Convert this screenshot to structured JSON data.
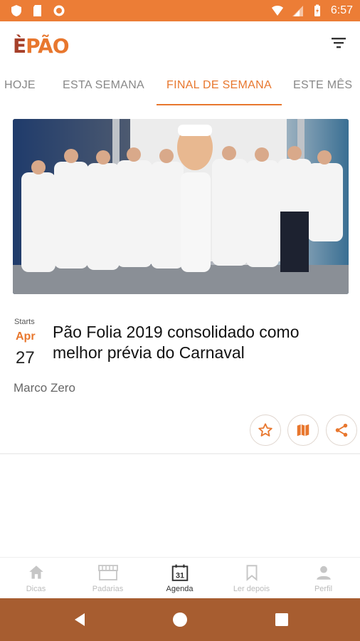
{
  "status_bar": {
    "time": "6:57"
  },
  "app": {
    "logo_prefix": "È",
    "logo_main": "PÃO"
  },
  "tabs": [
    {
      "label": "HOJE"
    },
    {
      "label": "ESTA SEMANA"
    },
    {
      "label": "FINAL DE SEMANA",
      "active": true
    },
    {
      "label": "ESTE MÊS"
    }
  ],
  "event": {
    "starts_label": "Starts",
    "month": "Apr",
    "day": "27",
    "title": "Pão Folia 2019 consolidado como melhor prévia do Carnaval",
    "venue": "Marco Zero"
  },
  "bottom_nav": [
    {
      "label": "Dicas",
      "icon": "home-icon"
    },
    {
      "label": "Padarias",
      "icon": "storefront-icon"
    },
    {
      "label": "Agenda",
      "icon": "calendar-icon",
      "active": true,
      "badge": "31"
    },
    {
      "label": "Ler depois",
      "icon": "bookmark-icon"
    },
    {
      "label": "Perfil",
      "icon": "person-icon"
    }
  ],
  "colors": {
    "accent": "#e8772e",
    "status_bar": "#ec7d36",
    "system_nav": "#a75d30",
    "brand_dark": "#a6402a"
  }
}
